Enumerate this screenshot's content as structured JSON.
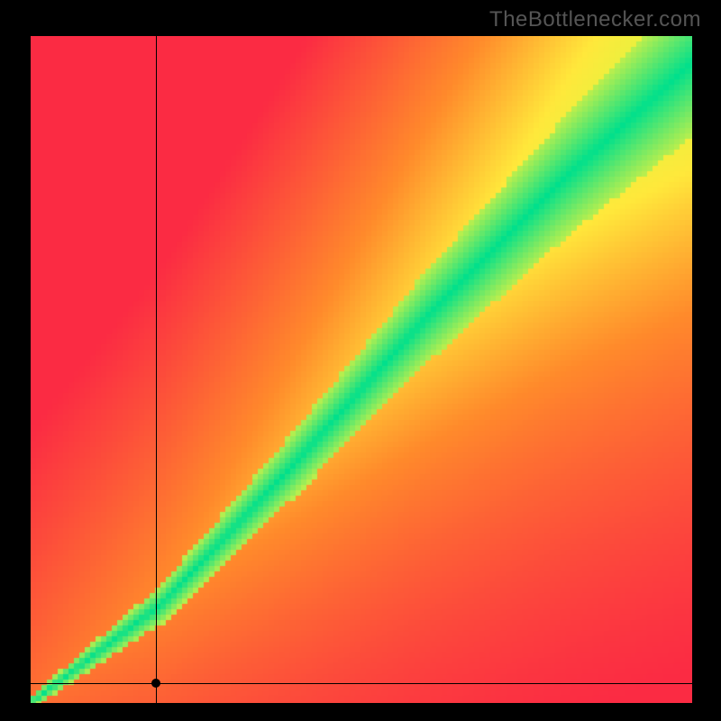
{
  "watermark": "TheBottlenecker.com",
  "chart_data": {
    "type": "heatmap",
    "title": "",
    "xlabel": "",
    "ylabel": "",
    "xlim": [
      0,
      100
    ],
    "ylim": [
      0,
      100
    ],
    "grid": false,
    "legend": false,
    "optimal_band": {
      "description": "Green diagonal band where components are balanced; width grows with x.",
      "center_line": [
        {
          "x": 0,
          "y": 0
        },
        {
          "x": 20,
          "y": 15
        },
        {
          "x": 40,
          "y": 36
        },
        {
          "x": 60,
          "y": 58
        },
        {
          "x": 80,
          "y": 78
        },
        {
          "x": 100,
          "y": 96
        }
      ],
      "band_half_width": [
        {
          "x": 0,
          "half_width": 1
        },
        {
          "x": 20,
          "half_width": 3
        },
        {
          "x": 40,
          "half_width": 5
        },
        {
          "x": 60,
          "half_width": 7
        },
        {
          "x": 80,
          "half_width": 9
        },
        {
          "x": 100,
          "half_width": 11
        }
      ]
    },
    "color_scale": [
      {
        "balance": 0.0,
        "color": "#fb2b43"
      },
      {
        "balance": 0.45,
        "color": "#ff8a2b"
      },
      {
        "balance": 0.75,
        "color": "#ffe83b"
      },
      {
        "balance": 0.9,
        "color": "#e7f23e"
      },
      {
        "balance": 1.0,
        "color": "#00e08c"
      }
    ],
    "crosshair": {
      "x": 19,
      "y": 3
    },
    "marker": {
      "x": 19,
      "y": 3
    },
    "pixelation": 6
  }
}
